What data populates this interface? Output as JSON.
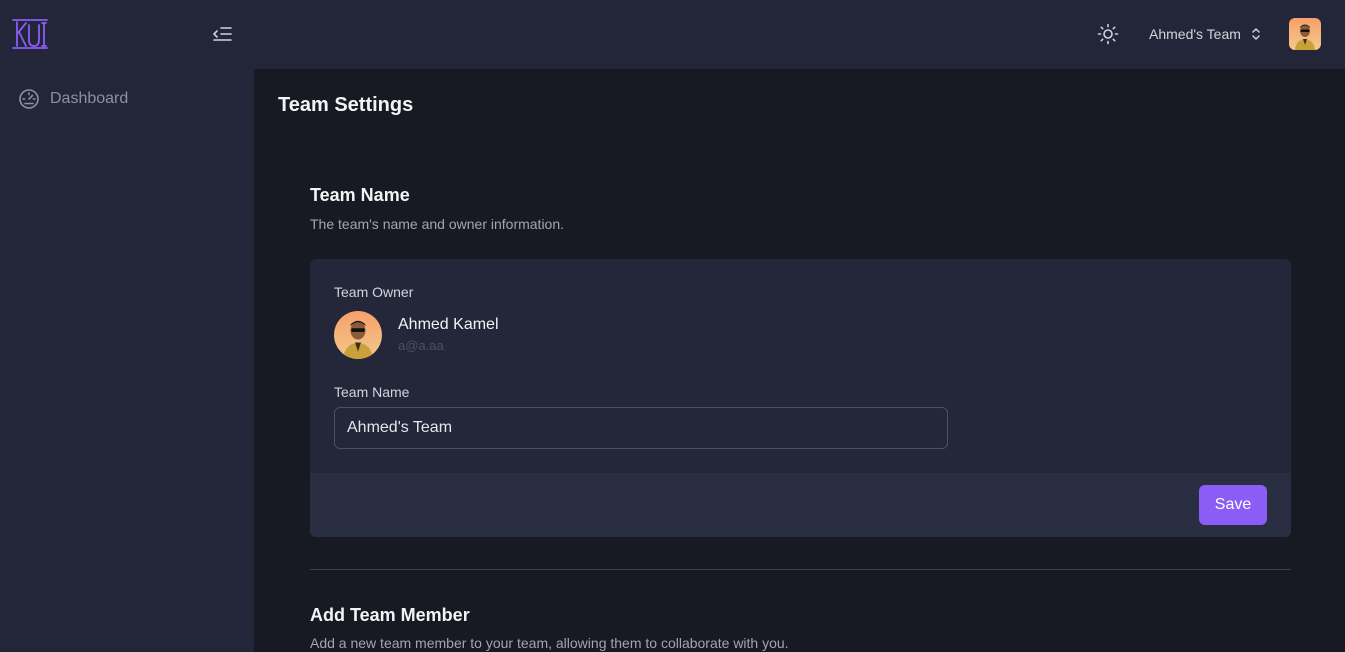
{
  "brand": {
    "logo_text": "KUI",
    "accent_color": "#8b5cf6"
  },
  "sidebar": {
    "collapse_icon": "menu-collapse-icon",
    "items": [
      {
        "label": "Dashboard",
        "icon": "gauge-icon"
      }
    ]
  },
  "header": {
    "theme_icon": "sun-icon",
    "team_switcher": {
      "label": "Ahmed's Team",
      "icon": "chevron-up-down-icon"
    },
    "avatar": "user-avatar"
  },
  "page": {
    "title": "Team Settings"
  },
  "team_name_section": {
    "title": "Team Name",
    "description": "The team's name and owner information.",
    "owner_label": "Team Owner",
    "owner": {
      "name": "Ahmed Kamel",
      "email": "a@a.aa"
    },
    "name_label": "Team Name",
    "name_value": "Ahmed's Team",
    "save_label": "Save"
  },
  "add_member_section": {
    "title": "Add Team Member",
    "description": "Add a new team member to your team, allowing them to collaborate with you."
  }
}
